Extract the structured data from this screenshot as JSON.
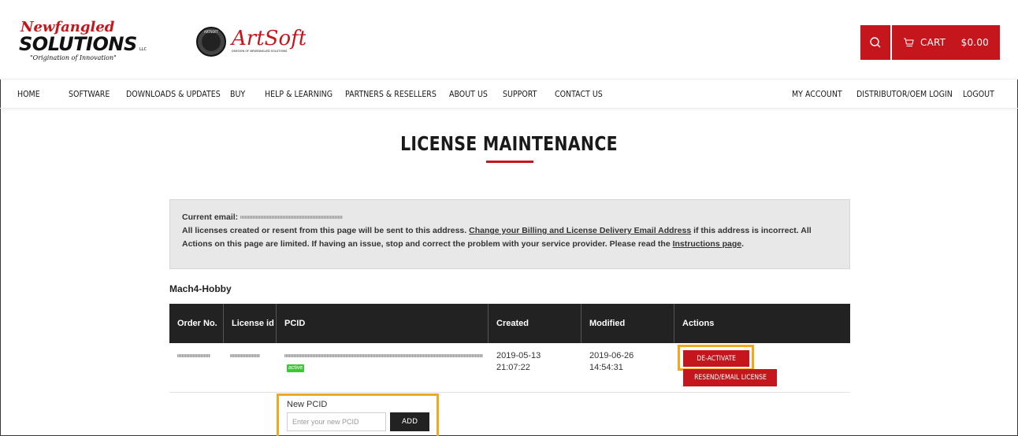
{
  "brand": {
    "logo_main": "Newfangled SOLUTIONS",
    "logo_llc": "LLC",
    "tagline": "\"Origination of Innovation\"",
    "logo_secondary": "ArtSoft",
    "logo_secondary_sub": "DIVISION OF NEWFANGLED SOLUTIONS",
    "seal_text": "ARTSOFT"
  },
  "header": {
    "search_icon": "search-icon",
    "cart_label": "CART",
    "cart_total": "$0.00"
  },
  "nav": {
    "left": [
      "HOME",
      "SOFTWARE",
      "DOWNLOADS & UPDATES",
      "BUY",
      "HELP & LEARNING",
      "PARTNERS & RESELLERS",
      "ABOUT US",
      "SUPPORT",
      "CONTACT US"
    ],
    "right": [
      "MY ACCOUNT",
      "DISTRIBUTOR/OEM LOGIN",
      "LOGOUT"
    ]
  },
  "page": {
    "title": "LICENSE MAINTENANCE"
  },
  "notice": {
    "email_label": "Current email:",
    "text_1": "All licenses created or resent from this page will be sent to this address.",
    "link_change": "Change your Billing and License Delivery Email Address",
    "text_2": "if this address is incorrect. All Actions on this page are limited. If having an issue, stop and correct the problem with your service provider. Please read the",
    "link_instructions": "Instructions page",
    "text_3": "."
  },
  "section": {
    "title": "Mach4-Hobby"
  },
  "table": {
    "headers": [
      "Order No.",
      "License id",
      "PCID",
      "Created",
      "Modified",
      "Actions"
    ],
    "rows": [
      {
        "status": "active",
        "created_date": "2019-05-13",
        "created_time": "21:07:22",
        "modified_date": "2019-06-26",
        "modified_time": "14:54:31",
        "action_deactivate": "DE-ACTIVATE",
        "action_resend": "RESEND/EMAIL LICENSE"
      }
    ],
    "new_pcid": {
      "label": "New PCID",
      "placeholder": "Enter your new PCID",
      "value": "",
      "add_label": "ADD"
    }
  },
  "colors": {
    "accent": "#c4161c",
    "header_dark": "#222222",
    "highlight": "#f0a81e",
    "active_badge": "#38c838"
  }
}
